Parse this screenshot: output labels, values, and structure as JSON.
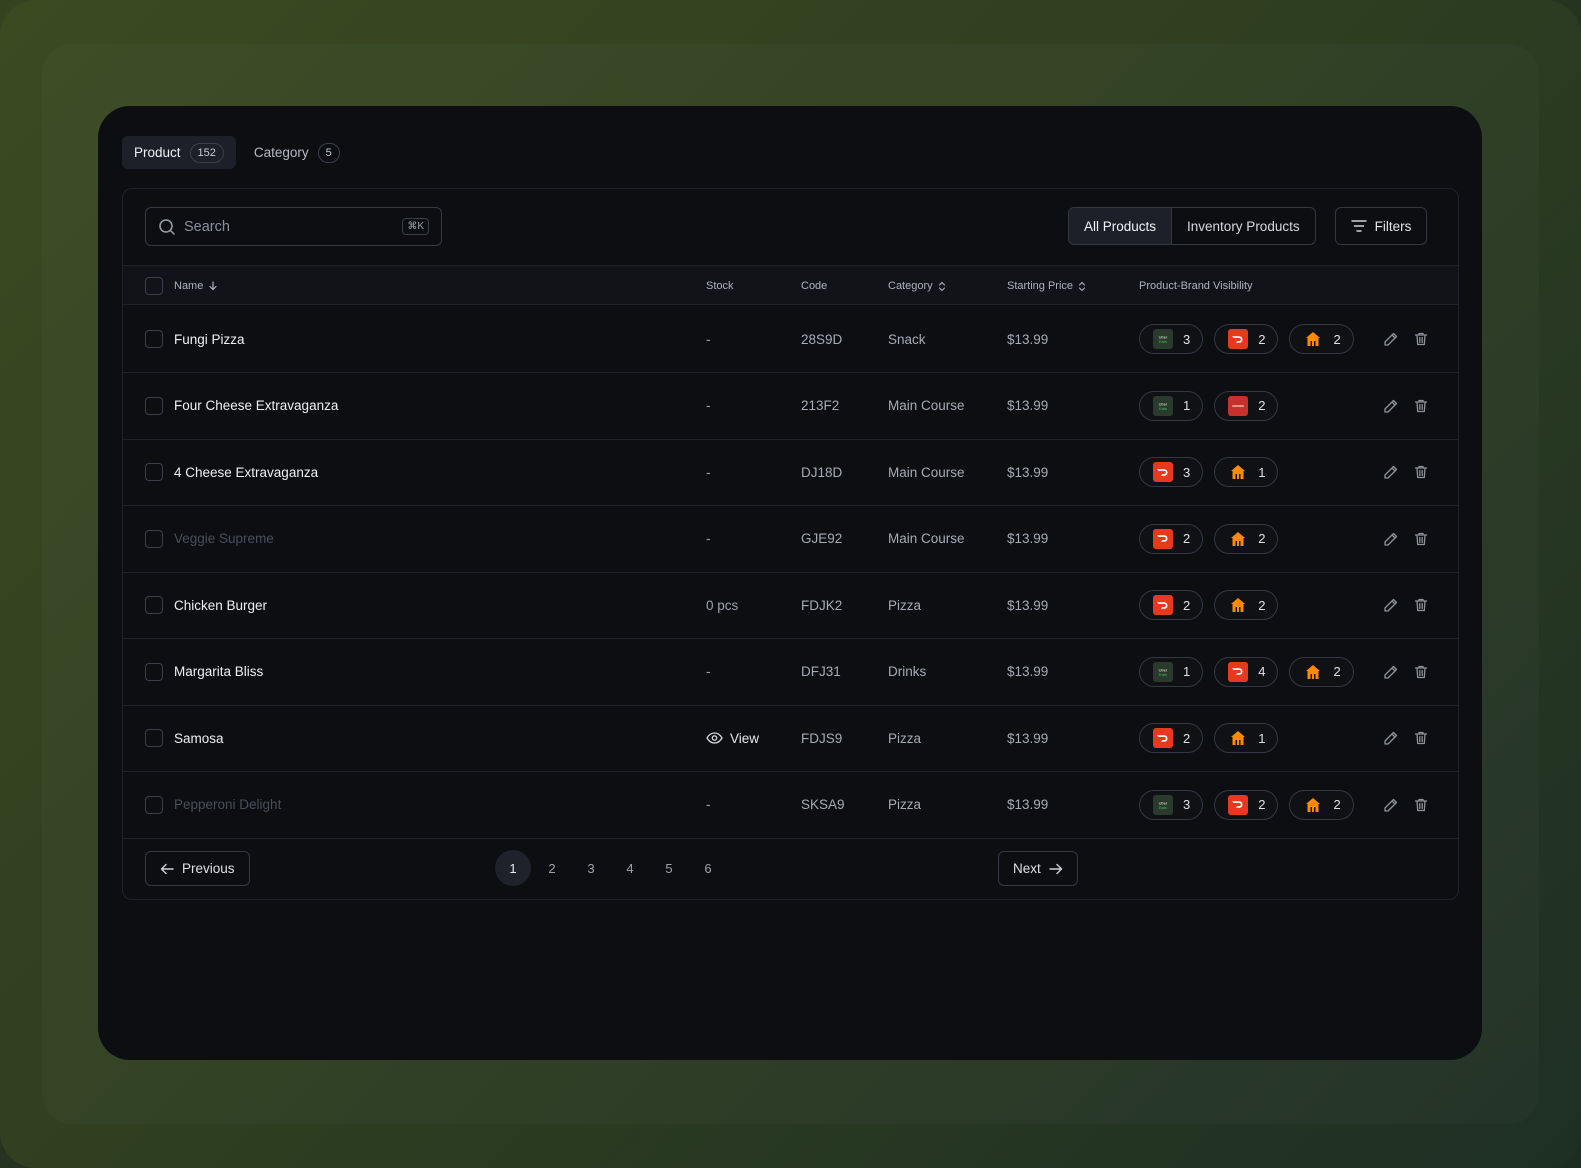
{
  "tabs": [
    {
      "label": "Product",
      "count": "152"
    },
    {
      "label": "Category",
      "count": "5"
    }
  ],
  "search": {
    "placeholder": "Search",
    "shortcut": "⌘K"
  },
  "segmented": {
    "all": "All Products",
    "inventory": "Inventory Products"
  },
  "filters_label": "Filters",
  "columns": {
    "name": "Name",
    "stock": "Stock",
    "code": "Code",
    "category": "Category",
    "price": "Starting Price",
    "visibility": "Product-Brand Visibility"
  },
  "rows": [
    {
      "name": "Fungi Pizza",
      "stock": "-",
      "code": "28S9D",
      "category": "Snack",
      "price": "$13.99",
      "brands": [
        {
          "logo": "uber-eats",
          "count": "3"
        },
        {
          "logo": "doordash",
          "count": "2"
        },
        {
          "logo": "restaurant-hut",
          "count": "2"
        }
      ]
    },
    {
      "name": "Four Cheese Extravaganza",
      "stock": "-",
      "code": "213F2",
      "category": "Main Course",
      "price": "$13.99",
      "brands": [
        {
          "logo": "uber-eats",
          "count": "1"
        },
        {
          "logo": "grubhub",
          "count": "2"
        }
      ]
    },
    {
      "name": "4 Cheese Extravaganza",
      "stock": "-",
      "code": "DJ18D",
      "category": "Main Course",
      "price": "$13.99",
      "brands": [
        {
          "logo": "doordash",
          "count": "3"
        },
        {
          "logo": "restaurant-hut",
          "count": "1"
        }
      ]
    },
    {
      "name": "Veggie Supreme",
      "stock": "-",
      "code": "GJE92",
      "category": "Main Course",
      "price": "$13.99",
      "dim": true,
      "brands": [
        {
          "logo": "doordash",
          "count": "2"
        },
        {
          "logo": "restaurant-hut",
          "count": "2"
        }
      ]
    },
    {
      "name": "Chicken Burger",
      "stock": "0 pcs",
      "code": "FDJK2",
      "category": "Pizza",
      "price": "$13.99",
      "brands": [
        {
          "logo": "doordash",
          "count": "2"
        },
        {
          "logo": "restaurant-hut",
          "count": "2"
        }
      ]
    },
    {
      "name": "Margarita Bliss",
      "stock": "-",
      "code": "DFJ31",
      "category": "Drinks",
      "price": "$13.99",
      "brands": [
        {
          "logo": "uber-eats",
          "count": "1"
        },
        {
          "logo": "doordash",
          "count": "4"
        },
        {
          "logo": "restaurant-hut",
          "count": "2"
        }
      ]
    },
    {
      "name": "Samosa",
      "stock": "View",
      "stock_is_link": true,
      "code": "FDJS9",
      "category": "Pizza",
      "price": "$13.99",
      "brands": [
        {
          "logo": "doordash",
          "count": "2"
        },
        {
          "logo": "restaurant-hut",
          "count": "1"
        }
      ]
    },
    {
      "name": "Pepperoni Delight",
      "stock": "-",
      "code": "SKSA9",
      "category": "Pizza",
      "price": "$13.99",
      "dim": true,
      "brands": [
        {
          "logo": "uber-eats",
          "count": "3"
        },
        {
          "logo": "doordash",
          "count": "2"
        },
        {
          "logo": "restaurant-hut",
          "count": "2"
        }
      ]
    }
  ],
  "pagination": {
    "previous": "Previous",
    "next": "Next",
    "pages": [
      "1",
      "2",
      "3",
      "4",
      "5",
      "6"
    ],
    "current": "1"
  }
}
